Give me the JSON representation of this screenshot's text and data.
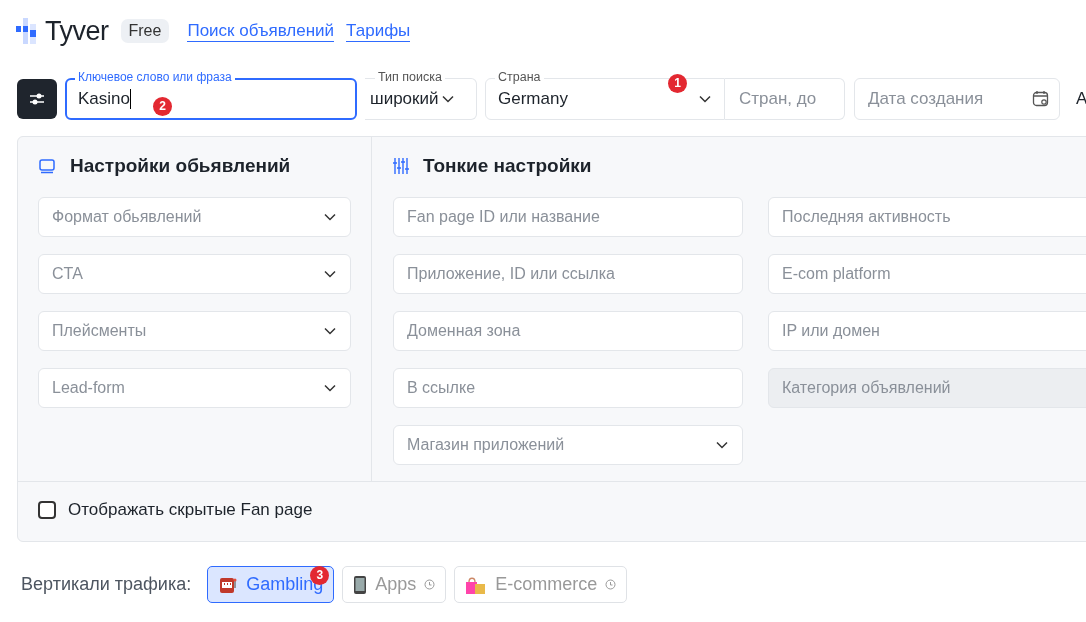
{
  "header": {
    "logo": "Tyver",
    "plan": "Free",
    "links": [
      {
        "label": "Поиск объявлений"
      },
      {
        "label": "Тарифы"
      }
    ]
  },
  "search": {
    "keyword": {
      "label": "Ключевое слово или фраза",
      "value": "Kasino",
      "focused": true,
      "marker": "2"
    },
    "search_type": {
      "label": "Тип поиска",
      "value": "широкий"
    },
    "country": {
      "label": "Страна",
      "value": "Germany",
      "marker": "1"
    },
    "countries_to": {
      "placeholder": "Стран, до"
    },
    "created": {
      "placeholder": "Дата создания"
    },
    "cut_text": "A"
  },
  "ad_settings": {
    "title": "Настройки обьявлений",
    "fields": [
      {
        "kind": "select",
        "placeholder": "Формат обьявлений",
        "disabled": false
      },
      {
        "kind": "select",
        "placeholder": "CTA",
        "disabled": false
      },
      {
        "kind": "select",
        "placeholder": "Плейсменты",
        "disabled": false
      },
      {
        "kind": "select",
        "placeholder": "Lead-form",
        "disabled": false
      }
    ]
  },
  "fine_settings": {
    "title": "Тонкие настройки",
    "columns": [
      [
        {
          "kind": "text",
          "placeholder": "Fan page ID или название",
          "disabled": false
        },
        {
          "kind": "text",
          "placeholder": "Приложение, ID или ссылка",
          "disabled": false
        },
        {
          "kind": "text",
          "placeholder": "Доменная зона",
          "disabled": false
        },
        {
          "kind": "text",
          "placeholder": "В ссылке",
          "disabled": false
        },
        {
          "kind": "select",
          "placeholder": "Магазин приложений",
          "disabled": false
        }
      ],
      [
        {
          "kind": "text",
          "placeholder": "Последняя активность",
          "disabled": false
        },
        {
          "kind": "text",
          "placeholder": "E-com platform",
          "disabled": false
        },
        {
          "kind": "text",
          "placeholder": "IP или домен",
          "disabled": false
        },
        {
          "kind": "text",
          "placeholder": "Категория объявлений",
          "disabled": true
        }
      ]
    ]
  },
  "hidden_fanpages": {
    "label": "Отображать скрытые Fan page",
    "checked": false
  },
  "verticals": {
    "label": "Вертикали трафика:",
    "items": [
      {
        "kind": "slot",
        "label": "Gambling",
        "selected": true,
        "disabled": false,
        "marker": "3"
      },
      {
        "kind": "phone",
        "label": "Apps",
        "selected": false,
        "disabled": true
      },
      {
        "kind": "bag",
        "label": "E-commerce",
        "selected": false,
        "disabled": true
      }
    ]
  }
}
